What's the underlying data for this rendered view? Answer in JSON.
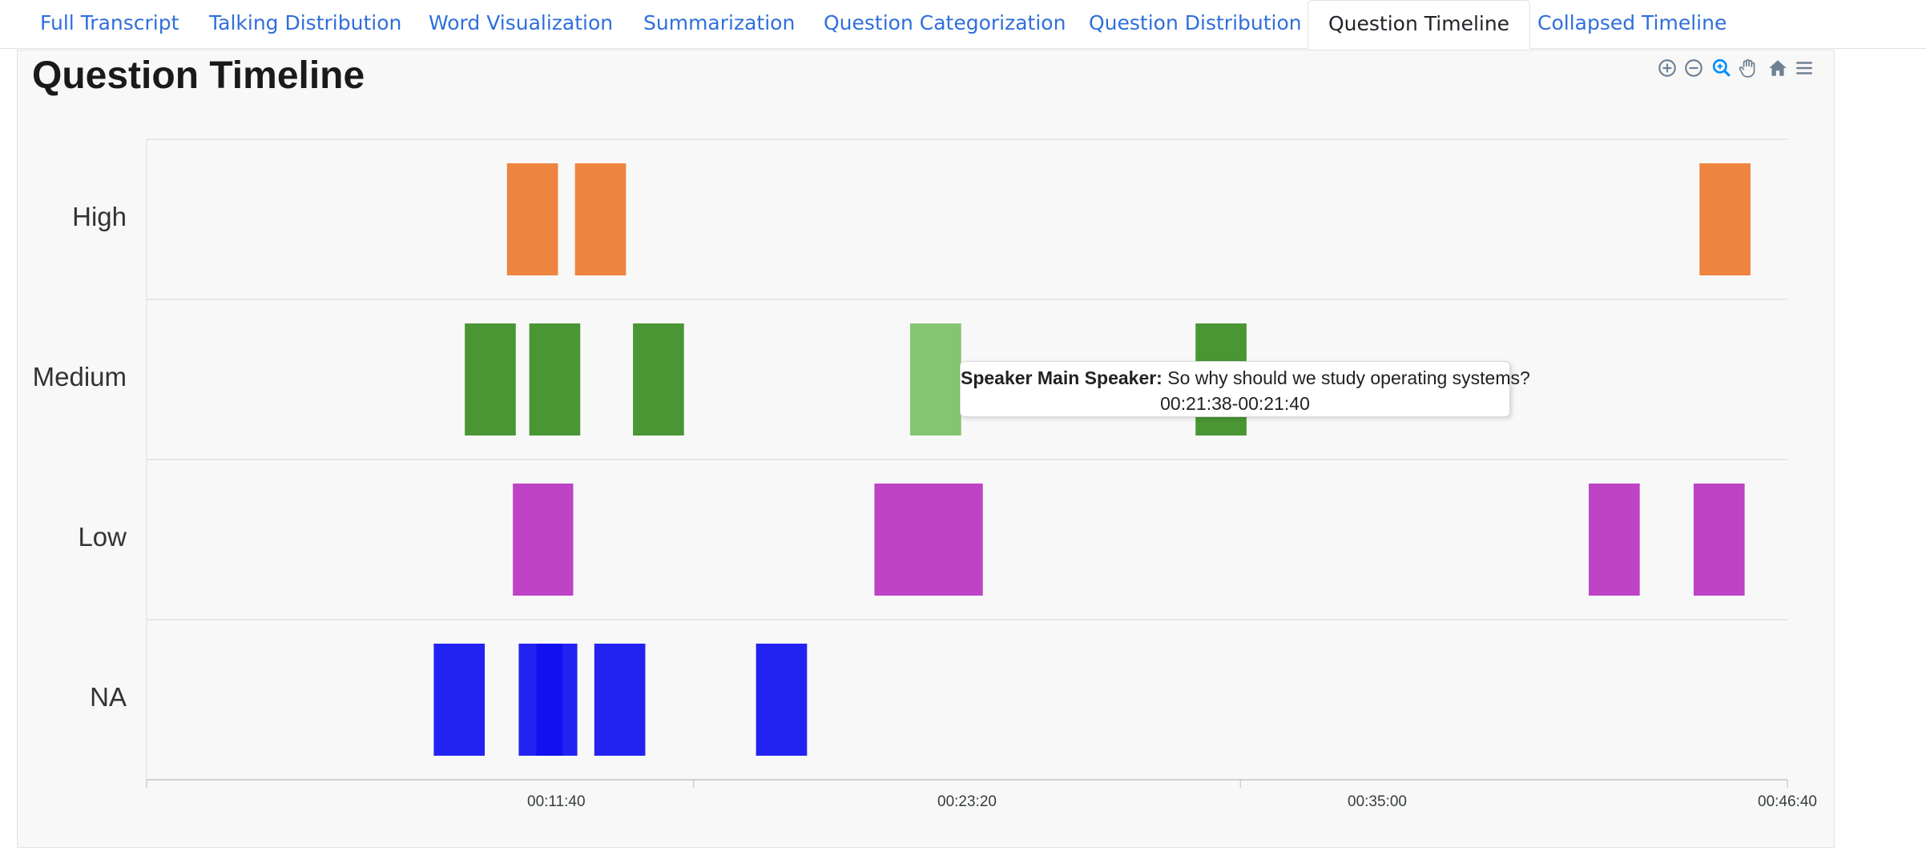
{
  "tabs": [
    {
      "label": "Full Transcript",
      "active": false
    },
    {
      "label": "Talking Distribution",
      "active": false
    },
    {
      "label": "Word Visualization",
      "active": false
    },
    {
      "label": "Summarization",
      "active": false
    },
    {
      "label": "Question Categorization",
      "active": false
    },
    {
      "label": "Question Distribution",
      "active": false
    },
    {
      "label": "Question Timeline",
      "active": true
    },
    {
      "label": "Collapsed Timeline",
      "active": false
    }
  ],
  "toolbar": {
    "icons": [
      "zoom-in-icon",
      "zoom-out-icon",
      "selection-zoom-icon",
      "pan-hand-icon",
      "reset-home-icon",
      "menu-icon"
    ]
  },
  "chart_data": {
    "type": "timeline",
    "title": "Question Timeline",
    "categories": [
      "High",
      "Medium",
      "Low",
      "NA"
    ],
    "x_ticks": [
      "00:11:40",
      "00:23:20",
      "00:35:00",
      "00:46:40"
    ],
    "x_range_seconds": [
      0,
      2800
    ],
    "colors": {
      "High": "#ec7a2f",
      "Medium": "#3b8d23",
      "Medium_hover": "#78c065",
      "Low": "#b933c0",
      "NA": "#1010f0"
    },
    "series": [
      {
        "name": "High",
        "bars": [
          [
            615,
            702
          ],
          [
            731,
            818
          ],
          [
            2650,
            2737
          ]
        ]
      },
      {
        "name": "Medium",
        "bars": [
          [
            543,
            630
          ],
          [
            653,
            740
          ],
          [
            830,
            917
          ],
          [
            1303,
            1390
          ],
          [
            1790,
            1877
          ]
        ]
      },
      {
        "name": "Low",
        "bars": [
          [
            625,
            728
          ],
          [
            1242,
            1427
          ],
          [
            2461,
            2548
          ],
          [
            2640,
            2727
          ]
        ]
      },
      {
        "name": "NA",
        "bars": [
          [
            490,
            577
          ],
          [
            635,
            710
          ],
          [
            665,
            735
          ],
          [
            764,
            851
          ],
          [
            1040,
            1127
          ]
        ]
      }
    ],
    "hovered": {
      "category": "Medium",
      "bar_index": 3
    }
  },
  "tooltip": {
    "speaker_label": "Speaker Main Speaker:",
    "text": "So why should we study operating systems?",
    "time_range": "00:21:38-00:21:40"
  }
}
